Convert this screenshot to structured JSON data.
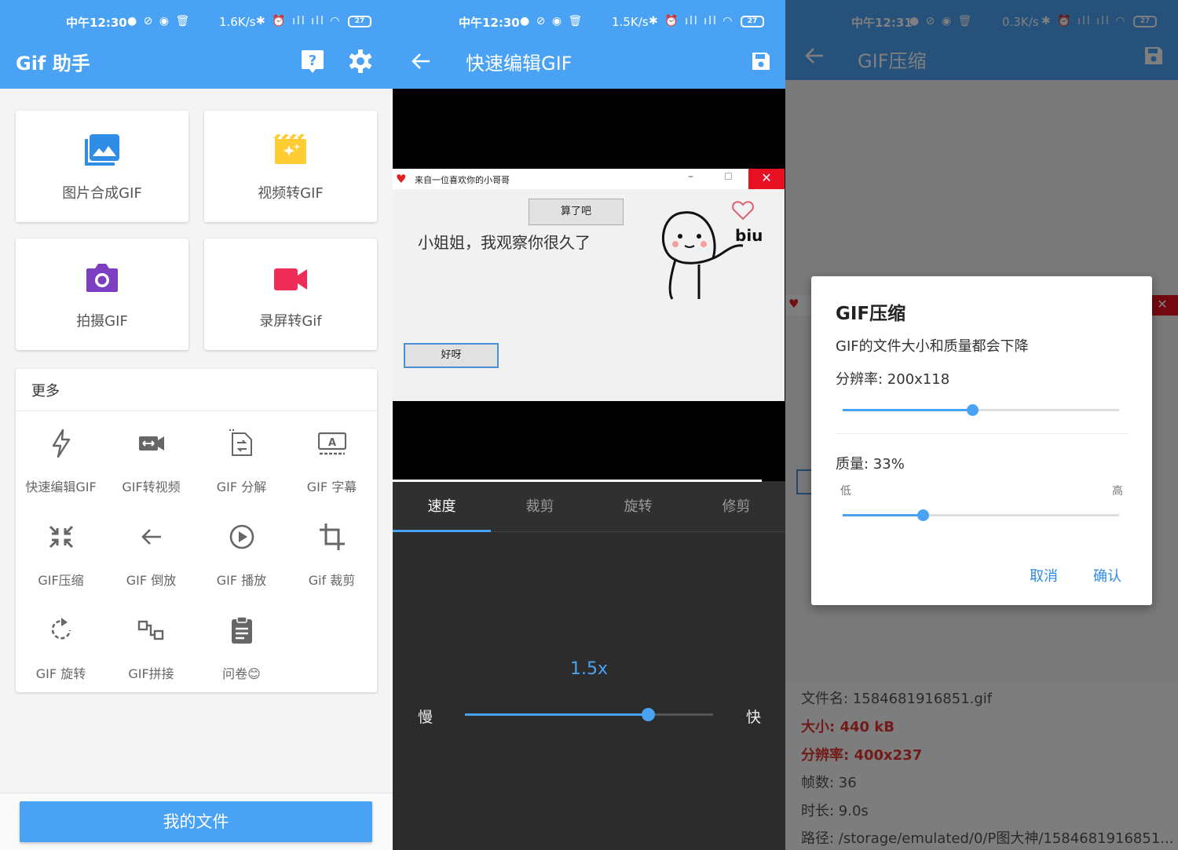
{
  "status1": {
    "time": "中午12:30",
    "speed": "1.6K/s",
    "battery": "27"
  },
  "status2": {
    "time": "中午12:30",
    "speed": "1.5K/s",
    "battery": "27"
  },
  "status3": {
    "time": "中午12:31",
    "speed": "0.3K/s",
    "battery": "27"
  },
  "colors": {
    "primary": "#4aa2f5",
    "images_icon": "#2f8de6",
    "video_icon": "#ffcc33",
    "camera_icon": "#7c3fc2",
    "record_icon": "#ee2e59",
    "danger": "#e53935"
  },
  "home": {
    "title": "Gif 助手",
    "tiles": [
      {
        "label": "图片合成GIF",
        "icon": "image-icon"
      },
      {
        "label": "视频转GIF",
        "icon": "video-clip-icon"
      },
      {
        "label": "拍摄GIF",
        "icon": "camera-icon"
      },
      {
        "label": "录屏转Gif",
        "icon": "video-camera-icon"
      }
    ],
    "more_title": "更多",
    "more_items": [
      {
        "label": "快速编辑GIF",
        "icon": "flash-icon"
      },
      {
        "label": "GIF转视频",
        "icon": "video-convert-icon"
      },
      {
        "label": "GIF 分解",
        "icon": "split-file-icon"
      },
      {
        "label": "GIF 字幕",
        "icon": "subtitle-icon"
      },
      {
        "label": "GIF压缩",
        "icon": "compress-icon"
      },
      {
        "label": "GIF 倒放",
        "icon": "arrow-back-icon"
      },
      {
        "label": "GIF 播放",
        "icon": "play-circle-icon"
      },
      {
        "label": "Gif 裁剪",
        "icon": "crop-icon"
      },
      {
        "label": "GIF 旋转",
        "icon": "rotate-icon"
      },
      {
        "label": "GIF拼接",
        "icon": "join-icon"
      },
      {
        "label": "问卷😊",
        "icon": "clipboard-icon"
      }
    ],
    "my_files": "我的文件"
  },
  "editor": {
    "title": "快速编辑GIF",
    "gif_window_title": "来自一位喜欢你的小哥哥",
    "gif_button_top": "算了吧",
    "gif_text": "小姐姐，我观察你很久了",
    "gif_button_bottom": "好呀",
    "gif_sticker_text": "biu",
    "tabs": [
      "速度",
      "裁剪",
      "旋转",
      "修剪"
    ],
    "active_tab": 0,
    "speed_value": "1.5x",
    "speed_fraction": 0.74,
    "slow_label": "慢",
    "fast_label": "快"
  },
  "compress": {
    "title": "GIF压缩",
    "info": {
      "filename": "文件名: 1584681916851.gif",
      "size": "大小: 440 kB",
      "resolution": "分辨率: 400x237",
      "frames": "帧数: 36",
      "duration": "时长: 9.0s",
      "path": "路径: /storage/emulated/0/P图大神/1584681916851..."
    },
    "dialog": {
      "title": "GIF压缩",
      "description": "GIF的文件大小和质量都会下降",
      "resolution_label": "分辨率: 200x118",
      "resolution_fraction": 0.47,
      "quality_label": "质量: 33%",
      "quality_fraction": 0.29,
      "low_label": "低",
      "high_label": "高",
      "cancel": "取消",
      "confirm": "确认"
    }
  }
}
